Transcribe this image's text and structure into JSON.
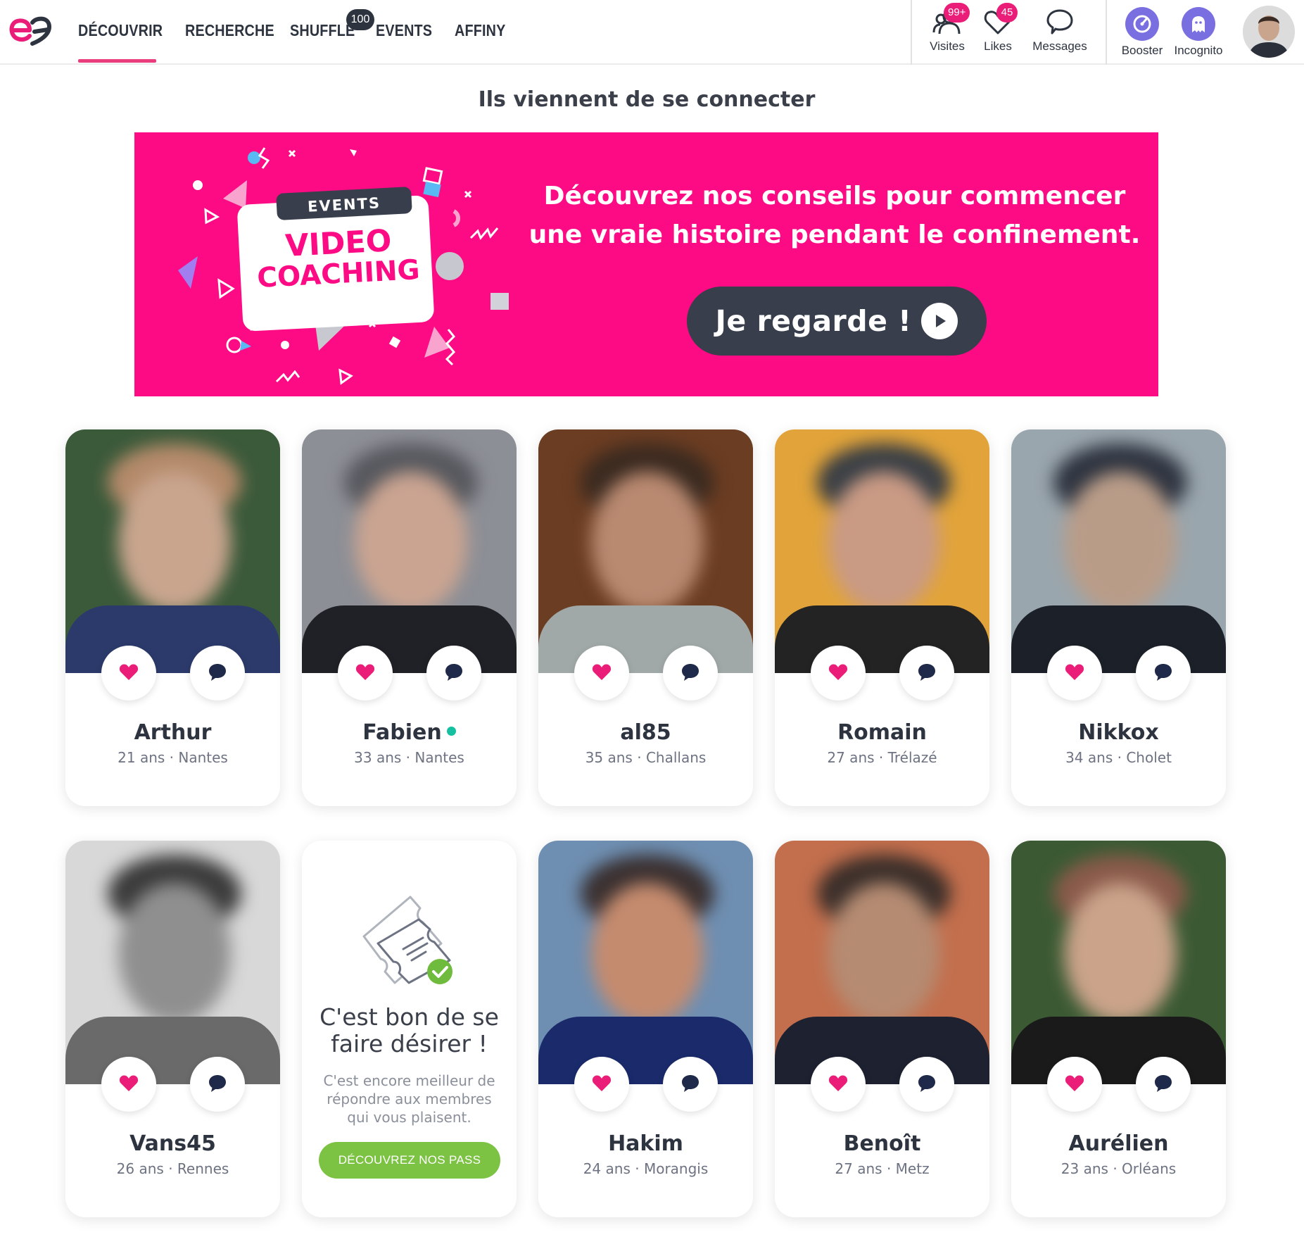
{
  "nav": {
    "items": [
      {
        "label": "DÉCOUVRIR"
      },
      {
        "label": "RECHERCHE"
      },
      {
        "label": "SHUFFLE"
      },
      {
        "label": "EVENTS"
      },
      {
        "label": "AFFINY"
      }
    ],
    "active_index": 0,
    "shuffle_badge": "100"
  },
  "header_actions": {
    "visites": {
      "label": "Visites",
      "badge": "99+",
      "icon": "users-icon"
    },
    "likes": {
      "label": "Likes",
      "badge": "45",
      "icon": "heart-outline-icon"
    },
    "messages": {
      "label": "Messages",
      "icon": "speech-bubble-icon"
    },
    "booster": {
      "label": "Booster",
      "icon": "rocket-gauge-icon"
    },
    "incognito": {
      "label": "Incognito",
      "icon": "ghost-icon"
    }
  },
  "section_title": "Ils viennent de se connecter",
  "banner": {
    "tag": "EVENTS",
    "art_title_line1": "VIDEO",
    "art_title_line2": "COACHING",
    "headline_line1": "Découvrez nos conseils pour commencer",
    "headline_line2": "une vraie histoire pendant le confinement.",
    "cta": "Je regarde !"
  },
  "profiles": [
    {
      "name": "Arthur",
      "age": "21 ans",
      "city": "Nantes",
      "online": false
    },
    {
      "name": "Fabien",
      "age": "33 ans",
      "city": "Nantes",
      "online": true
    },
    {
      "name": "al85",
      "age": "35 ans",
      "city": "Challans",
      "online": false
    },
    {
      "name": "Romain",
      "age": "27 ans",
      "city": "Trélazé",
      "online": false
    },
    {
      "name": "Nikkox",
      "age": "34 ans",
      "city": "Cholet",
      "online": false
    },
    {
      "name": "Vans45",
      "age": "26 ans",
      "city": "Rennes",
      "online": false
    },
    {
      "name": "Hakim",
      "age": "24 ans",
      "city": "Morangis",
      "online": false
    },
    {
      "name": "Benoît",
      "age": "27 ans",
      "city": "Metz",
      "online": false
    },
    {
      "name": "Aurélien",
      "age": "23 ans",
      "city": "Orléans",
      "online": false
    }
  ],
  "pass_card": {
    "title_line1": "C'est bon de se",
    "title_line2": "faire désirer !",
    "text": "C'est encore meilleur de répondre aux membres qui vous plaisent.",
    "button": "DÉCOUVREZ NOS PASS"
  },
  "colors": {
    "accent": "#ea1e79",
    "banner": "#fd0a85",
    "dark": "#2d3440",
    "online": "#14c0a0",
    "pass_button": "#7cc243"
  },
  "meta_separator": "·"
}
